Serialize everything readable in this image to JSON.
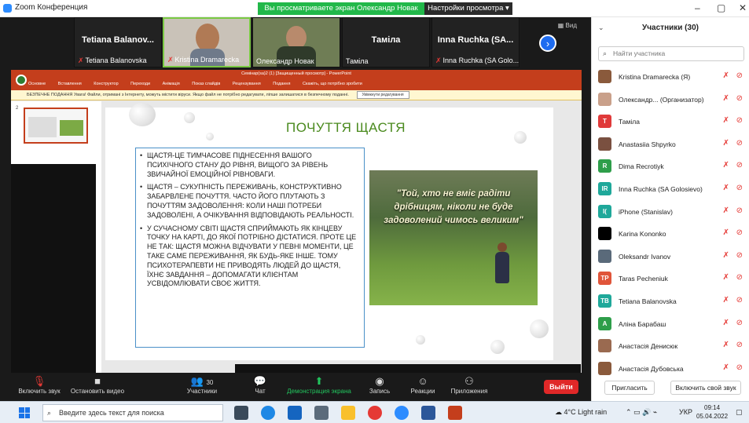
{
  "window": {
    "title": "Zoom Конференция",
    "share_notice": "Вы просматриваете экран Олександр Новак",
    "view_settings": "Настройки просмотра",
    "view_label": "Вид",
    "minimize": "–",
    "maximize": "▢",
    "close": "✕"
  },
  "tiles": [
    {
      "name": "Tetiana  Balanov...",
      "caption": "Tetiana Balanovska"
    },
    {
      "name": "",
      "caption": "Kristina Dramarecka"
    },
    {
      "name": "",
      "caption": "Олександр Новак"
    },
    {
      "name": "Таміла",
      "caption": "Таміла"
    },
    {
      "name": "Inna Ruchka (SA...",
      "caption": "Inna Ruchka (SA Golo..."
    }
  ],
  "next_arrow": "›",
  "ppt": {
    "titlebar": "Семінар(sa)2 (1) [Защищенный просмотр] - PowerPoint",
    "menu": [
      "Файл",
      "Основне",
      "Вставлення",
      "Конструктор",
      "Переходи",
      "Анімація",
      "Показ слайдів",
      "Рецензування",
      "Подання",
      "Скажіть, що потрібно зробити"
    ],
    "warning": "БЕЗПЕЧНЕ ПОДАННЯ  Увага! Файли, отримані з Інтернету, можуть містити віруси. Якщо файл не потрібно редагувати, ліпше залишатися в безпечному поданні.",
    "warning_button": "Увімкнути редагування",
    "slide_number": "2",
    "heading": "ПОЧУТТЯ ЩАСТЯ",
    "bullets": [
      "Щастя-це тимчасове піднесення вашого психічного стану до рівня, вищого за рівень звичайної емоційної рівноваги.",
      "Щастя – сукупність переживань, конструктивно забарвлене почуття. Часто його плутають з почуттям задоволення: коли наші потреби задоволені, а очікування відповідають реальності.",
      "У сучасному світі щастя сприймають як кінцеву точку на карті, до якої потрібно дістатися. Проте це не так: щастя можна відчувати у певні моменти, це таке саме переживання, як будь-яке інше. Тому психотерапевти не приводять людей до щастя, їхнє завдання – допомагати клієнтам усвідомлювати своє життя."
    ],
    "quote": "\"Той, хто не вміє радіти дрібницям, ніколи не буде задоволений чимось великим\""
  },
  "toolbar": {
    "mute": "Включить звук",
    "video": "Остановить видео",
    "participants": "Участники",
    "participants_count": "30",
    "chat": "Чат",
    "share": "Демонстрация экрана",
    "record": "Запись",
    "reactions": "Реакции",
    "apps": "Приложения",
    "leave": "Выйти"
  },
  "panel": {
    "title": "Участники (30)",
    "search_placeholder": "Найти участника",
    "participants": [
      {
        "name": "Kristina Dramarecka (Я)",
        "initials": "",
        "color": "#8a5a3c"
      },
      {
        "name": "Олександр... (Организатор)",
        "initials": "",
        "color": "#c9a08a"
      },
      {
        "name": "Таміла",
        "initials": "T",
        "color": "#e03a3a"
      },
      {
        "name": "Anastasiia Shpyrko",
        "initials": "",
        "color": "#7a5040"
      },
      {
        "name": "Dima Recrotiyk",
        "initials": "R",
        "color": "#2e9e4a"
      },
      {
        "name": "Inna Ruchka (SA Golosievo)",
        "initials": "IR",
        "color": "#1fa89a"
      },
      {
        "name": "iPhone (Stanislav)",
        "initials": "I(",
        "color": "#1fa89a"
      },
      {
        "name": "Karina Kononko",
        "initials": "",
        "color": "#000000"
      },
      {
        "name": "Oleksandr Ivanov",
        "initials": "",
        "color": "#5a6a7a"
      },
      {
        "name": "Taras Pecheniuk",
        "initials": "TP",
        "color": "#e0553a"
      },
      {
        "name": "Tetiana Balanovska",
        "initials": "TB",
        "color": "#1fa89a"
      },
      {
        "name": "Аліна Барабаш",
        "initials": "A",
        "color": "#2e9e4a"
      },
      {
        "name": "Анастасія Денисюк",
        "initials": "",
        "color": "#9a6a50"
      },
      {
        "name": "Анастасія Дубовська",
        "initials": "",
        "color": "#8a5a3c"
      }
    ],
    "invite": "Пригласить",
    "unmute_me": "Включить свой звук"
  },
  "taskbar": {
    "search": "Введите здесь текст для поиска",
    "weather": "4°C  Light rain",
    "lang": "УКР",
    "time": "09:14",
    "date": "05.04.2022"
  }
}
